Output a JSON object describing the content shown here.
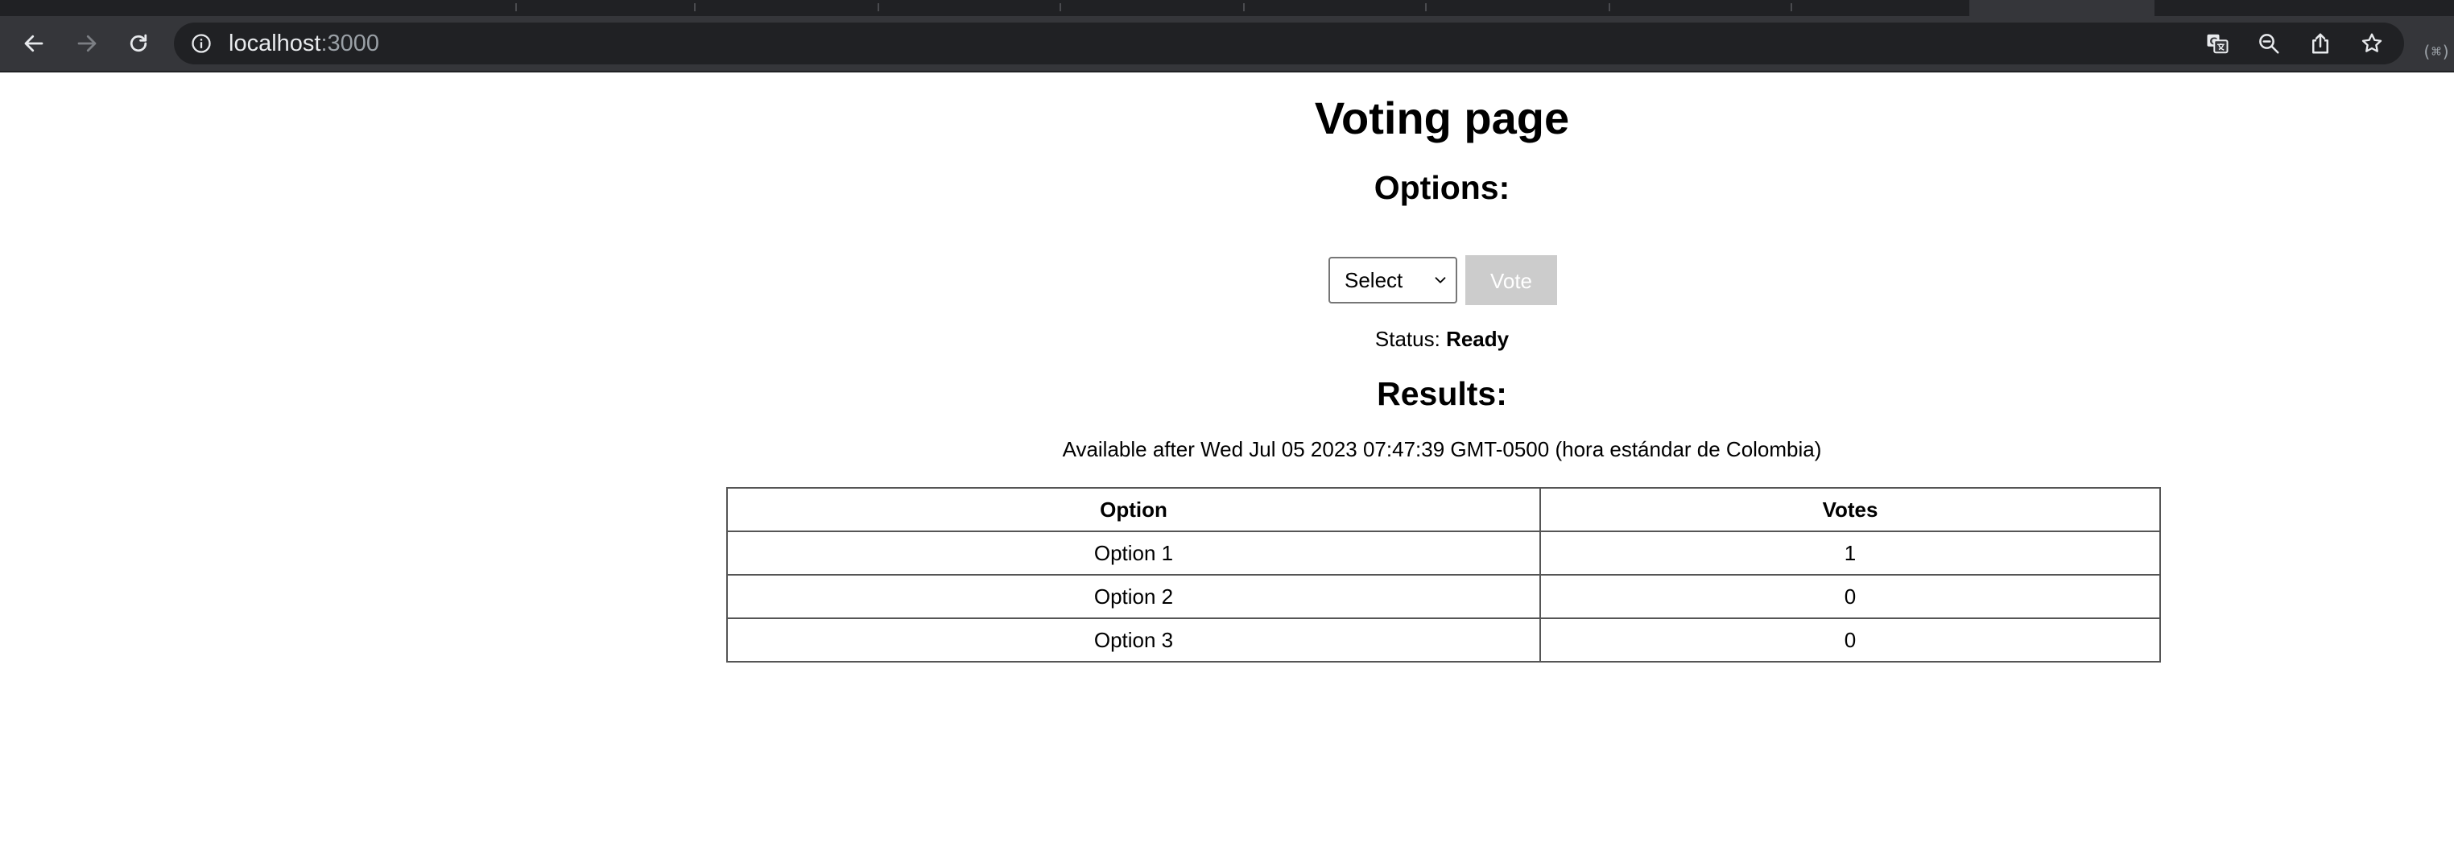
{
  "browser": {
    "url_host": "localhost",
    "url_port": ":3000",
    "icons": [
      "back-icon",
      "forward-icon",
      "reload-icon",
      "site-info-icon",
      "translate-icon",
      "zoom-out-icon",
      "share-icon",
      "bookmark-star-icon",
      "extension-icon"
    ]
  },
  "page": {
    "title": "Voting page",
    "options_heading": "Options:",
    "select_value": "Select",
    "vote_label": "Vote",
    "status_label": "Status:",
    "status_value": "Ready",
    "results_heading": "Results:",
    "available_text": "Available after Wed Jul 05 2023 07:47:39 GMT-0500 (hora estándar de Colombia)",
    "table": {
      "headers": [
        "Option",
        "Votes"
      ],
      "rows": [
        [
          "Option 1",
          "1"
        ],
        [
          "Option 2",
          "0"
        ],
        [
          "Option 3",
          "0"
        ]
      ]
    },
    "colors": {
      "vote_button_disabled_bg": "#cccccc",
      "vote_button_text": "#ffffff"
    }
  }
}
